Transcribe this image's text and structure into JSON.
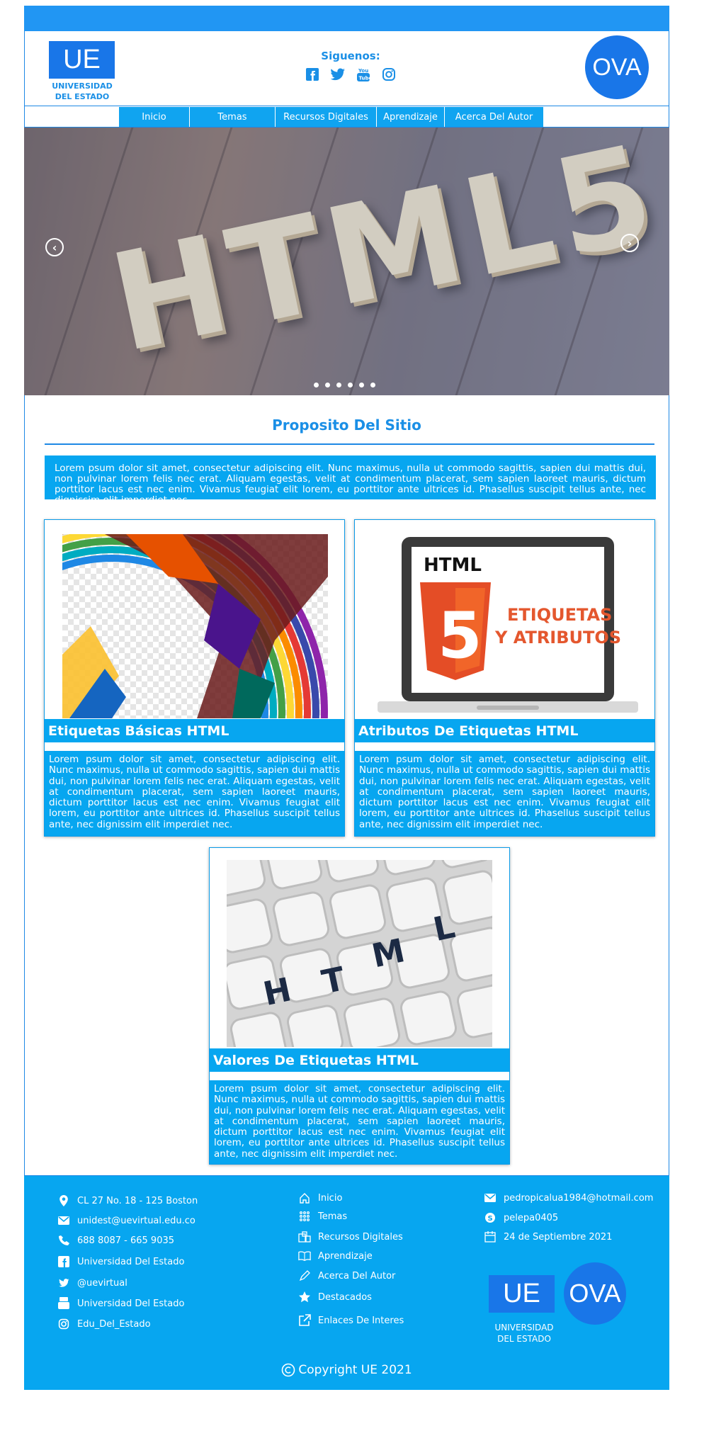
{
  "header": {
    "logo_text": "UE",
    "logo_caption_line1": "UNIVERSIDAD",
    "logo_caption_line2": "DEL ESTADO",
    "follow_label": "Siguenos:",
    "social_icons": [
      "facebook-icon",
      "twitter-icon",
      "youtube-icon",
      "instagram-icon"
    ],
    "ova_text": "OVA"
  },
  "nav": {
    "items": [
      "Inicio",
      "Temas",
      "Recursos Digitales",
      "Aprendizaje",
      "Acerca Del Autor"
    ]
  },
  "slider": {
    "image_text": "HTML5",
    "prev_icon": "chevron-left-icon",
    "next_icon": "chevron-right-icon",
    "dot_count": 6
  },
  "purpose": {
    "title": "Proposito Del Sitio",
    "text": "Lorem psum dolor sit amet, consectetur adipiscing elit. Nunc maximus, nulla ut commodo sagittis, sapien dui mattis dui, non pulvinar lorem felis nec erat. Aliquam egestas, velit at condimentum placerat, sem sapien laoreet mauris, dictum porttitor lacus est nec enim. Vivamus feugiat elit lorem, eu porttitor ante ultrices id. Phasellus suscipit tellus ante, nec dignissim elit imperdiet nec."
  },
  "cards": [
    {
      "title": "Etiquetas Básicas HTML",
      "text": "Lorem psum dolor sit amet, consectetur adipiscing elit. Nunc maximus, nulla ut commodo sagittis, sapien dui mattis dui, non pulvinar lorem felis nec erat. Aliquam egestas, velit at condimentum placerat, sem sapien laoreet mauris, dictum porttitor lacus est nec enim. Vivamus feugiat elit lorem, eu porttitor ante ultrices id. Phasellus suscipit tellus ante, nec dignissim elit imperdiet nec."
    },
    {
      "title": "Atributos De Etiquetas HTML",
      "image_label_top": "HTML",
      "image_label_line1": "ETIQUETAS",
      "image_label_line2": "Y ATRIBUTOS",
      "image_badge": "5",
      "text": "Lorem psum dolor sit amet, consectetur adipiscing elit. Nunc maximus, nulla ut commodo sagittis, sapien dui mattis dui, non pulvinar lorem felis nec erat. Aliquam egestas, velit at condimentum placerat, sem sapien laoreet mauris, dictum porttitor lacus est nec enim. Vivamus feugiat elit lorem, eu porttitor ante ultrices id. Phasellus suscipit tellus ante, nec dignissim elit imperdiet nec."
    },
    {
      "title": "Valores De Etiquetas HTML",
      "image_keys": [
        "H",
        "T",
        "M",
        "L"
      ],
      "text": "Lorem psum dolor sit amet, consectetur adipiscing elit. Nunc maximus, nulla ut commodo sagittis, sapien dui mattis dui, non pulvinar lorem felis nec erat. Aliquam egestas, velit at condimentum placerat, sem sapien laoreet mauris, dictum porttitor lacus est nec enim. Vivamus feugiat elit lorem, eu porttitor ante ultrices id. Phasellus suscipit tellus ante, nec dignissim elit imperdiet nec."
    }
  ],
  "footer": {
    "contact": [
      {
        "icon": "location-icon",
        "text": "CL 27 No. 18 - 125 Boston"
      },
      {
        "icon": "mail-icon",
        "text": "unidest@uevirtual.edu.co"
      },
      {
        "icon": "phone-icon",
        "text": "688 8087 - 665 9035"
      },
      {
        "icon": "facebook-icon",
        "text": "Universidad Del Estado"
      },
      {
        "icon": "twitter-icon",
        "text": "@uevirtual"
      },
      {
        "icon": "youtube-icon",
        "text": "Universidad Del Estado"
      },
      {
        "icon": "instagram-icon",
        "text": "Edu_Del_Estado"
      }
    ],
    "links": [
      {
        "icon": "home-icon",
        "text": "Inicio"
      },
      {
        "icon": "grid-icon",
        "text": "Temas"
      },
      {
        "icon": "books-icon",
        "text": "Recursos Digitales"
      },
      {
        "icon": "open-book-icon",
        "text": "Aprendizaje"
      },
      {
        "icon": "pen-icon",
        "text": "Acerca Del Autor"
      },
      {
        "icon": "star-icon",
        "text": "Destacados"
      },
      {
        "icon": "external-link-icon",
        "text": "Enlaces De Interes"
      }
    ],
    "author": [
      {
        "icon": "mail-icon",
        "text": "pedropicalua1984@hotmail.com"
      },
      {
        "icon": "skype-icon",
        "text": "pelepa0405"
      },
      {
        "icon": "calendar-icon",
        "text": "24 de Septiembre 2021"
      }
    ],
    "logo_text": "UE",
    "logo_caption_line1": "UNIVERSIDAD",
    "logo_caption_line2": "DEL ESTADO",
    "ova_text": "OVA",
    "copyright": "Copyright UE 2021"
  },
  "colors": {
    "accent": "#07a6f0",
    "brand_blue": "#1976e8",
    "top_bar": "#2196f3"
  }
}
